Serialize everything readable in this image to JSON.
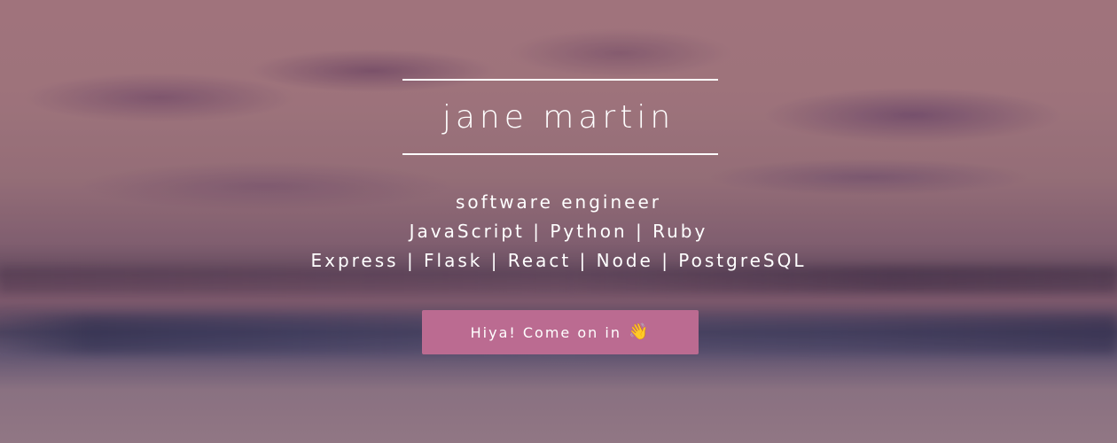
{
  "hero": {
    "name": "jane martin",
    "role": "software engineer",
    "languages": "JavaScript | Python | Ruby",
    "frameworks": "Express | Flask | React | Node | PostgreSQL"
  },
  "cta": {
    "label": "Hiya! Come on in",
    "icon": "waving-hand-icon",
    "icon_glyph": "👋",
    "color": "#bb6b91"
  },
  "colors": {
    "text": "#ffffff",
    "background_top": "#b6878d",
    "background_mid": "#6c5568",
    "background_bottom": "#a48b96"
  }
}
